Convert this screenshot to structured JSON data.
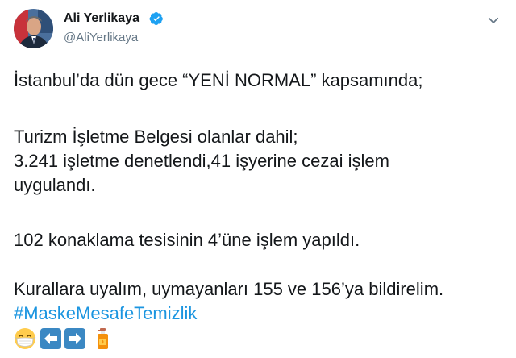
{
  "author": {
    "name": "Ali Yerlikaya",
    "handle": "@AliYerlikaya",
    "verified": true
  },
  "tweet": {
    "lines": [
      "İstanbul’da dün gece “YENİ NORMAL” kapsamında;",
      "Turizm İşletme Belgesi olanlar dahil;",
      "3.241 işletme denetlendi,41 işyerine cezai işlem",
      "uygulandı.",
      "102 konaklama tesisinin 4’üne işlem yapıldı.",
      "Kurallara uyalım, uymayanları 155 ve 156’ya bildirelim."
    ],
    "hashtag": "#MaskeMesafeTemizlik",
    "emojis": [
      "face-with-medical-mask-icon",
      "left-arrow-icon",
      "right-arrow-icon",
      "lotion-bottle-icon"
    ]
  },
  "colors": {
    "text": "#14171a",
    "secondary": "#657786",
    "link": "#1b95e0",
    "verified": "#1da1f2"
  }
}
